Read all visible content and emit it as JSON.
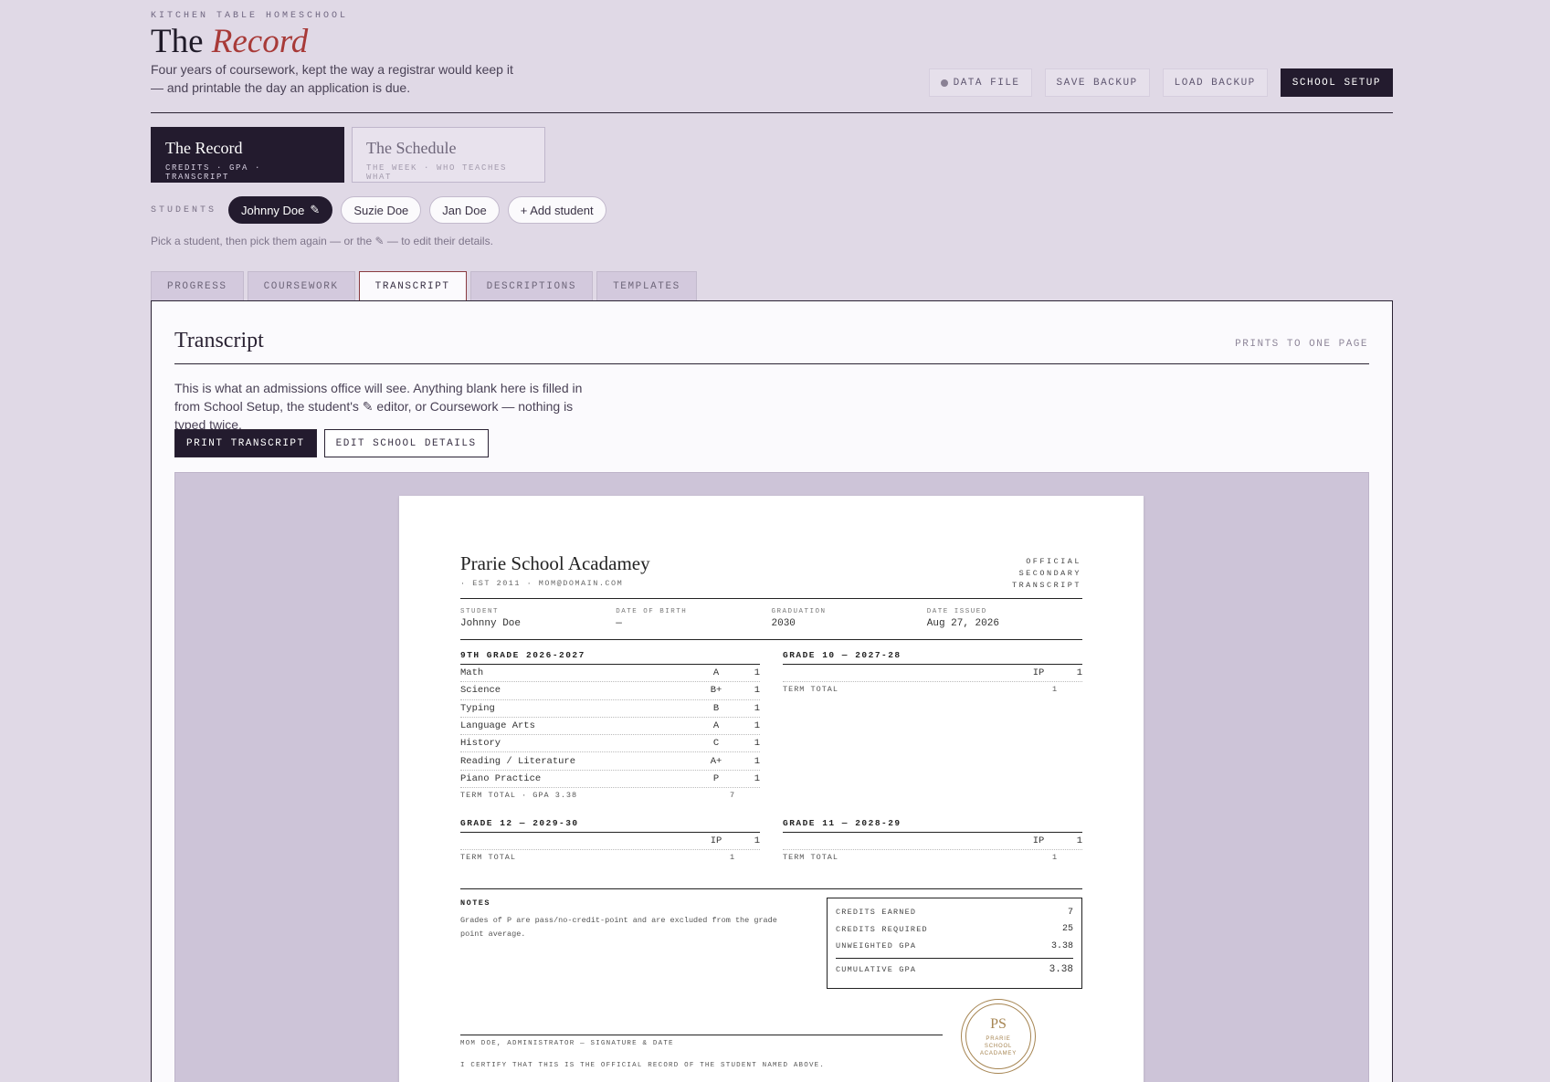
{
  "header": {
    "eyebrow": "KITCHEN TABLE HOMESCHOOL",
    "title_plain": "The",
    "title_italic": "Record",
    "tagline": "Four years of coursework, kept the way a registrar would keep it — and printable the day an application is due.",
    "buttons": {
      "data_file": "DATA FILE",
      "save_backup": "SAVE BACKUP",
      "load_backup": "LOAD BACKUP",
      "school_setup": "SCHOOL SETUP"
    }
  },
  "sections": [
    {
      "title": "The Record",
      "subtitle": "CREDITS · GPA · TRANSCRIPT",
      "active": true
    },
    {
      "title": "The Schedule",
      "subtitle": "THE WEEK · WHO TEACHES WHAT",
      "active": false
    }
  ],
  "students": {
    "label": "STUDENTS",
    "list": [
      "Johnny Doe",
      "Suzie Doe",
      "Jan Doe"
    ],
    "add_label": "+ Add student",
    "edit_glyph": "✎",
    "hint": "Pick a student, then pick them again — or the ✎ — to edit their details."
  },
  "tabs": [
    "PROGRESS",
    "COURSEWORK",
    "TRANSCRIPT",
    "DESCRIPTIONS",
    "TEMPLATES"
  ],
  "active_tab": "TRANSCRIPT",
  "panel": {
    "title": "Transcript",
    "note": "PRINTS TO ONE PAGE",
    "description": "This is what an admissions office will see. Anything blank here is filled in from School Setup, the student's ✎ editor, or Coursework — nothing is typed twice.",
    "print_label": "PRINT TRANSCRIPT",
    "edit_label": "EDIT SCHOOL DETAILS"
  },
  "transcript": {
    "school_name": "Prarie School Acadamey",
    "school_meta": "· EST 2011 · MOM@DOMAIN.COM",
    "official": "OFFICIAL SECONDARY TRANSCRIPT",
    "info": [
      {
        "k": "STUDENT",
        "v": "Johnny Doe"
      },
      {
        "k": "DATE OF BIRTH",
        "v": "—"
      },
      {
        "k": "GRADUATION",
        "v": "2030"
      },
      {
        "k": "DATE ISSUED",
        "v": "Aug 27, 2026"
      }
    ],
    "terms": {
      "g9": {
        "heading": "9TH GRADE 2026-2027",
        "courses": [
          {
            "course": "Math",
            "grade": "A",
            "credit": "1"
          },
          {
            "course": "Science",
            "grade": "B+",
            "credit": "1"
          },
          {
            "course": "Typing",
            "grade": "B",
            "credit": "1"
          },
          {
            "course": "Language Arts",
            "grade": "A",
            "credit": "1"
          },
          {
            "course": "History",
            "grade": "C",
            "credit": "1"
          },
          {
            "course": "Reading / Literature",
            "grade": "A+",
            "credit": "1"
          },
          {
            "course": "Piano Practice",
            "grade": "P",
            "credit": "1"
          }
        ],
        "total_label": "TERM TOTAL · GPA 3.38",
        "total_credits": "7"
      },
      "g10": {
        "heading": "GRADE 10 — 2027-28",
        "courses": [
          {
            "course": "",
            "grade": "IP",
            "credit": "1"
          }
        ],
        "total_label": "TERM TOTAL",
        "total_credits": "1"
      },
      "g12": {
        "heading": "GRADE 12 — 2029-30",
        "courses": [
          {
            "course": "",
            "grade": "IP",
            "credit": "1"
          }
        ],
        "total_label": "TERM TOTAL",
        "total_credits": "1"
      },
      "g11": {
        "heading": "GRADE 11 — 2028-29",
        "courses": [
          {
            "course": "",
            "grade": "IP",
            "credit": "1"
          }
        ],
        "total_label": "TERM TOTAL",
        "total_credits": "1"
      }
    },
    "notes_heading": "NOTES",
    "notes_text": "Grades of P are pass/no-credit-point and are excluded from the grade point average.",
    "summary": {
      "credits_earned_label": "CREDITS EARNED",
      "credits_earned": "7",
      "credits_required_label": "CREDITS REQUIRED",
      "credits_required": "25",
      "unweighted_label": "UNWEIGHTED GPA",
      "unweighted": "3.38",
      "cumulative_label": "CUMULATIVE GPA",
      "cumulative": "3.38"
    },
    "signature_caption": "MOM DOE, ADMINISTRATOR — SIGNATURE & DATE",
    "certify": "I CERTIFY THAT THIS IS THE OFFICIAL RECORD OF THE STUDENT NAMED ABOVE.",
    "seal": {
      "initials": "PS",
      "name": "PRARIE SCHOOL ACADAMEY"
    }
  }
}
